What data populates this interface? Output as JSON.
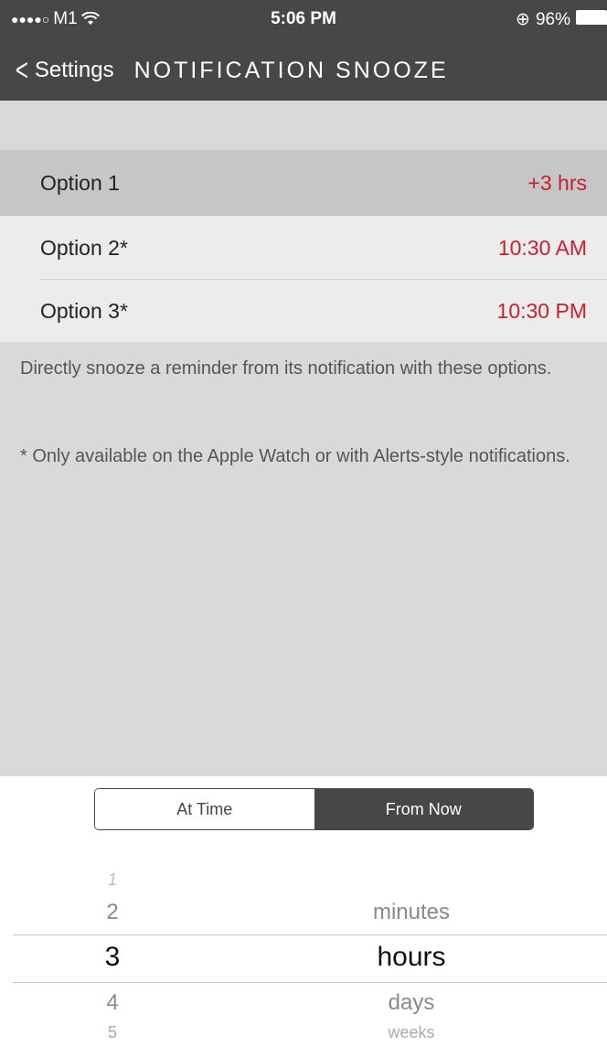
{
  "status_bar": {
    "carrier": "M1",
    "time": "5:06 PM",
    "battery": "96%"
  },
  "nav": {
    "back_label": "Settings",
    "title": "NOTIFICATION SNOOZE"
  },
  "options": [
    {
      "label": "Option 1",
      "value": "+3 hrs"
    },
    {
      "label": "Option 2*",
      "value": "10:30 AM"
    },
    {
      "label": "Option 3*",
      "value": "10:30 PM"
    }
  ],
  "footer": {
    "description": "Directly snooze a reminder from its notification with these options.",
    "note": "* Only available on the Apple Watch or with Alerts-style notifications."
  },
  "segmented": {
    "left": "At Time",
    "right": "From Now",
    "selected": "From Now"
  },
  "picker": {
    "numbers": [
      "1",
      "2",
      "3",
      "4",
      "5"
    ],
    "units": [
      "minutes",
      "hours",
      "days",
      "weeks"
    ],
    "selected_number": "3",
    "selected_unit": "hours"
  },
  "colors": {
    "accent": "#c8202e",
    "bar": "#474747"
  }
}
